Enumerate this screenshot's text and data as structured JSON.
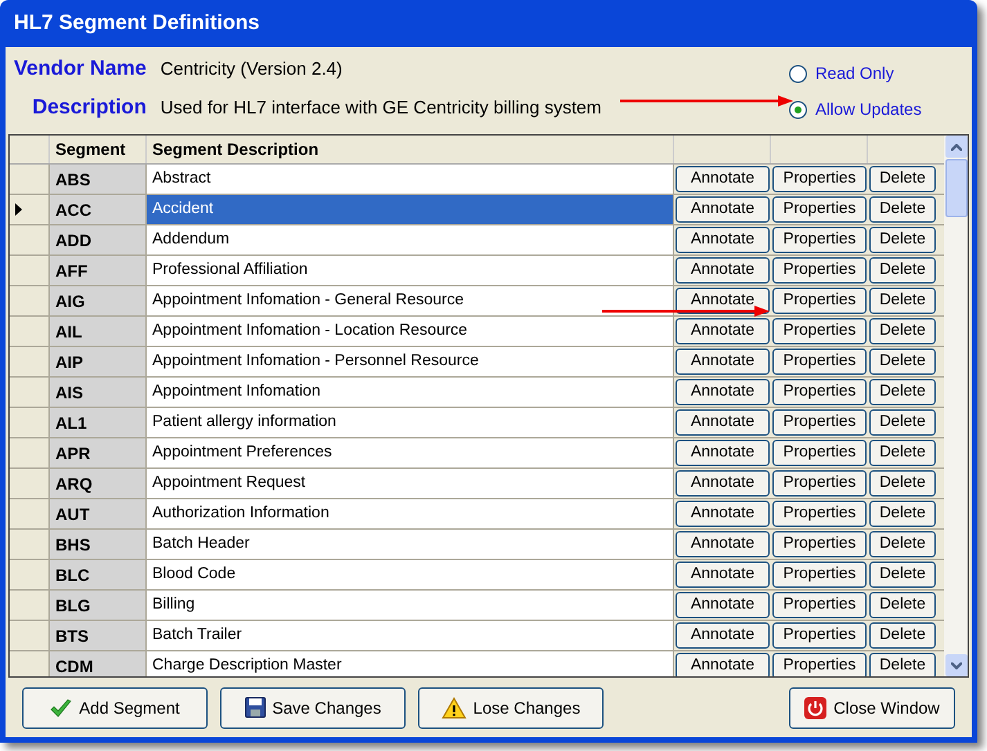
{
  "window": {
    "title": "HL7 Segment Definitions"
  },
  "vendor": {
    "label": "Vendor Name",
    "value": "Centricity (Version 2.4)"
  },
  "description": {
    "label": "Description",
    "value": "Used for HL7 interface with GE Centricity billing system"
  },
  "mode": [
    {
      "label": "Read Only",
      "selected": false
    },
    {
      "label": "Allow Updates",
      "selected": true
    }
  ],
  "table": {
    "columns": [
      "Segment",
      "Segment Description"
    ],
    "rows": [
      {
        "segment": "ABS",
        "description": "Abstract",
        "selected": false,
        "actions": [
          "Annotate",
          "Properties",
          "Delete"
        ]
      },
      {
        "segment": "ACC",
        "description": "Accident",
        "selected": true,
        "actions": [
          "Annotate",
          "Properties",
          "Delete"
        ]
      },
      {
        "segment": "ADD",
        "description": "Addendum",
        "selected": false,
        "actions": [
          "Annotate",
          "Properties",
          "Delete"
        ]
      },
      {
        "segment": "AFF",
        "description": "Professional Affiliation",
        "selected": false,
        "actions": [
          "Annotate",
          "Properties",
          "Delete"
        ]
      },
      {
        "segment": "AIG",
        "description": "Appointment Infomation - General Resource",
        "selected": false,
        "actions": [
          "Annotate",
          "Properties",
          "Delete"
        ]
      },
      {
        "segment": "AIL",
        "description": "Appointment Infomation - Location Resource",
        "selected": false,
        "actions": [
          "Annotate",
          "Properties",
          "Delete"
        ]
      },
      {
        "segment": "AIP",
        "description": "Appointment Infomation - Personnel Resource",
        "selected": false,
        "actions": [
          "Annotate",
          "Properties",
          "Delete"
        ]
      },
      {
        "segment": "AIS",
        "description": "Appointment Infomation",
        "selected": false,
        "actions": [
          "Annotate",
          "Properties",
          "Delete"
        ]
      },
      {
        "segment": "AL1",
        "description": "Patient allergy information",
        "selected": false,
        "actions": [
          "Annotate",
          "Properties",
          "Delete"
        ]
      },
      {
        "segment": "APR",
        "description": "Appointment Preferences",
        "selected": false,
        "actions": [
          "Annotate",
          "Properties",
          "Delete"
        ]
      },
      {
        "segment": "ARQ",
        "description": "Appointment Request",
        "selected": false,
        "actions": [
          "Annotate",
          "Properties",
          "Delete"
        ]
      },
      {
        "segment": "AUT",
        "description": "Authorization Information",
        "selected": false,
        "actions": [
          "Annotate",
          "Properties",
          "Delete"
        ]
      },
      {
        "segment": "BHS",
        "description": "Batch Header",
        "selected": false,
        "actions": [
          "Annotate",
          "Properties",
          "Delete"
        ]
      },
      {
        "segment": "BLC",
        "description": "Blood Code",
        "selected": false,
        "actions": [
          "Annotate",
          "Properties",
          "Delete"
        ]
      },
      {
        "segment": "BLG",
        "description": "Billing",
        "selected": false,
        "actions": [
          "Annotate",
          "Properties",
          "Delete"
        ]
      },
      {
        "segment": "BTS",
        "description": "Batch Trailer",
        "selected": false,
        "actions": [
          "Annotate",
          "Properties",
          "Delete"
        ]
      },
      {
        "segment": "CDM",
        "description": "Charge Description Master",
        "selected": false,
        "actions": [
          "Annotate",
          "Properties",
          "Delete"
        ]
      }
    ]
  },
  "buttons": [
    {
      "kind": "add",
      "label": "Add Segment"
    },
    {
      "kind": "save",
      "label": "Save Changes"
    },
    {
      "kind": "lose",
      "label": "Lose Changes"
    },
    {
      "kind": "close",
      "label": "Close Window"
    }
  ]
}
